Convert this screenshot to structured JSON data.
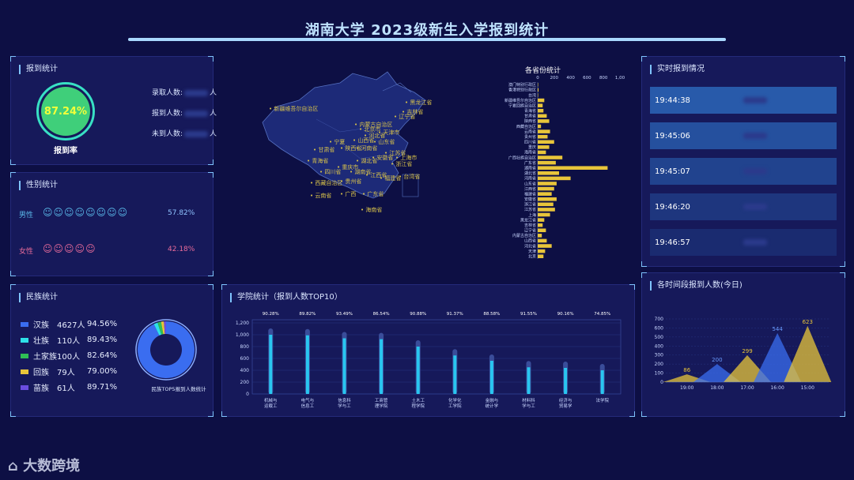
{
  "header": {
    "title": "湖南大学 2023级新生入学报到统计"
  },
  "report": {
    "title": "报到统计",
    "rate": "87.24%",
    "rate_label": "报到率",
    "admitted_label": "录取人数:",
    "reported_label": "报到人数:",
    "absent_label": "未到人数:",
    "unit": "人"
  },
  "gender": {
    "title": "性别统计",
    "male_label": "男性",
    "male_pct": "57.82%",
    "male_icon_count": 8,
    "male_color": "#5ab8e8",
    "female_label": "女性",
    "female_pct": "42.18%",
    "female_icon_count": 5,
    "female_color": "#e86b9a"
  },
  "ethnic": {
    "title": "民族统计",
    "caption": "民族TOP5报到人数统计",
    "rows": [
      {
        "name": "汉族",
        "count": "4627人",
        "pct": "94.56%",
        "color": "#3a6df0"
      },
      {
        "name": "壮族",
        "count": "110人",
        "pct": "89.43%",
        "color": "#2ee0e8"
      },
      {
        "name": "土家族",
        "count": "100人",
        "pct": "82.64%",
        "color": "#2fbf55"
      },
      {
        "name": "回族",
        "count": "79人",
        "pct": "79.00%",
        "color": "#e8c53a"
      },
      {
        "name": "苗族",
        "count": "61人",
        "pct": "89.71%",
        "color": "#6a4de0"
      }
    ],
    "donut_values": [
      4627,
      110,
      100,
      79,
      61
    ]
  },
  "map": {
    "labels": [
      "新疆维吾尔自治区",
      "黑龙江省",
      "吉林省",
      "辽宁省",
      "内蒙古自治区",
      "北京市",
      "河北省",
      "山东省",
      "山西省",
      "陕西省",
      "宁夏",
      "甘肃省",
      "青海省",
      "河南省",
      "江苏省",
      "安徽省",
      "湖北省",
      "四川省",
      "重庆市",
      "浙江省",
      "湖南省",
      "江西省",
      "西藏自治区",
      "贵州省",
      "福建省",
      "云南省",
      "广西",
      "广东省",
      "海南省",
      "台湾省",
      "上海市",
      "天津市"
    ]
  },
  "province_chart": {
    "title": "各省份统计",
    "axis_ticks": [
      "0",
      "200",
      "400",
      "600",
      "800",
      "1,00"
    ]
  },
  "realtime": {
    "title": "实时报到情况",
    "rows": [
      {
        "time": "19:44:38"
      },
      {
        "time": "19:45:06"
      },
      {
        "time": "19:45:07"
      },
      {
        "time": "19:46:20"
      },
      {
        "time": "19:46:57"
      }
    ]
  },
  "college_chart_title": "学院统计（报到人数TOP10）",
  "time_chart_title": "各时间段报到人数(今日)",
  "chart_data": [
    {
      "type": "bar",
      "title": "各省份统计",
      "orientation": "horizontal",
      "categories": [
        "澳门特别行政区",
        "香港特别行政区",
        "台湾",
        "新疆维吾尔自治区",
        "宁夏回族自治区",
        "青海省",
        "甘肃省",
        "陕西省",
        "西藏自治区",
        "云南省",
        "贵州省",
        "四川省",
        "重庆",
        "海南省",
        "广西壮族自治区",
        "广东省",
        "湖南省",
        "湖北省",
        "河南省",
        "山东省",
        "江西省",
        "福建省",
        "安徽省",
        "浙江省",
        "江苏省",
        "上海",
        "黑龙江省",
        "吉林省",
        "辽宁省",
        "内蒙古自治区",
        "山西省",
        "河北省",
        "天津",
        "北京"
      ],
      "values": [
        5,
        10,
        5,
        80,
        60,
        70,
        110,
        140,
        40,
        150,
        120,
        200,
        140,
        100,
        300,
        220,
        850,
        260,
        400,
        230,
        200,
        170,
        230,
        190,
        210,
        150,
        80,
        60,
        100,
        50,
        110,
        170,
        90,
        70
      ],
      "xlim": [
        0,
        1000
      ],
      "color": "#e8c53a"
    },
    {
      "type": "bar",
      "title": "学院统计（报到人数TOP10）",
      "categories": [
        "机械与运载工",
        "电气与信息工",
        "信息科学与工",
        "工商管理学院",
        "土木工程学院",
        "化学化工学院",
        "金融与统计学",
        "材料科学与工",
        "经济与贸易学",
        "法学院"
      ],
      "values": [
        1000,
        990,
        940,
        925,
        800,
        650,
        560,
        450,
        440,
        400
      ],
      "rates": [
        "90.28%",
        "89.82%",
        "93.49%",
        "86.54%",
        "90.88%",
        "91.37%",
        "88.58%",
        "91.55%",
        "90.16%",
        "74.85%"
      ],
      "yticks": [
        "0",
        "200",
        "400",
        "600",
        "800",
        "1,000",
        "1,200"
      ],
      "ylim": [
        0,
        1200
      ],
      "color": "#29c6f0"
    },
    {
      "type": "area",
      "title": "各时间段报到人数(今日)",
      "categories": [
        "19:00",
        "18:00",
        "17:00",
        "16:00",
        "15:00"
      ],
      "values": [
        86,
        200,
        299,
        544,
        623
      ],
      "yticks": [
        "0",
        "100",
        "200",
        "300",
        "400",
        "500",
        "600",
        "700"
      ],
      "ylim": [
        0,
        700
      ],
      "colors": [
        "#e8c53a",
        "#3a6df0",
        "#e8c53a",
        "#3a6df0",
        "#e8c53a"
      ]
    }
  ],
  "footer": {
    "logo": "大数跨境"
  }
}
